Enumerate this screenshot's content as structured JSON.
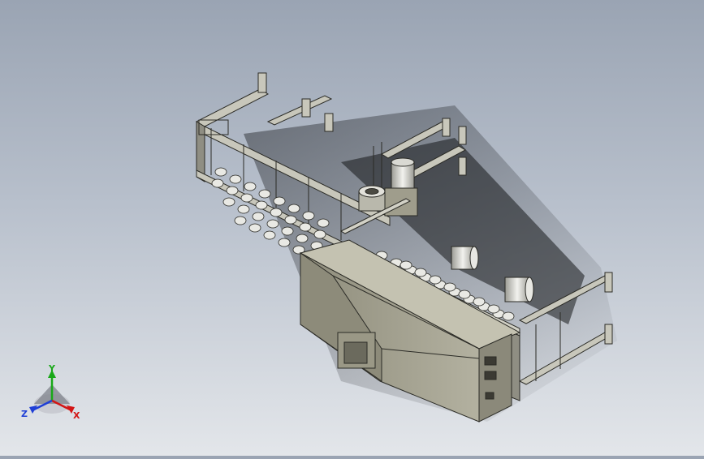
{
  "viewport": {
    "background_top": "#9aa4b3",
    "background_bottom": "#e3e6ea",
    "model": {
      "body_color": "#a9a795",
      "body_dark": "#6f6d60",
      "frame_color": "#c8c7bb",
      "edge_color": "#2b2b26",
      "roller_color": "#e9e9e4"
    }
  },
  "triad": {
    "x_label": "X",
    "y_label": "Y",
    "z_label": "Z",
    "x_color": "#d31515",
    "y_color": "#19a819",
    "z_color": "#1f3fd6",
    "icon": "coordinate-triad-icon"
  }
}
